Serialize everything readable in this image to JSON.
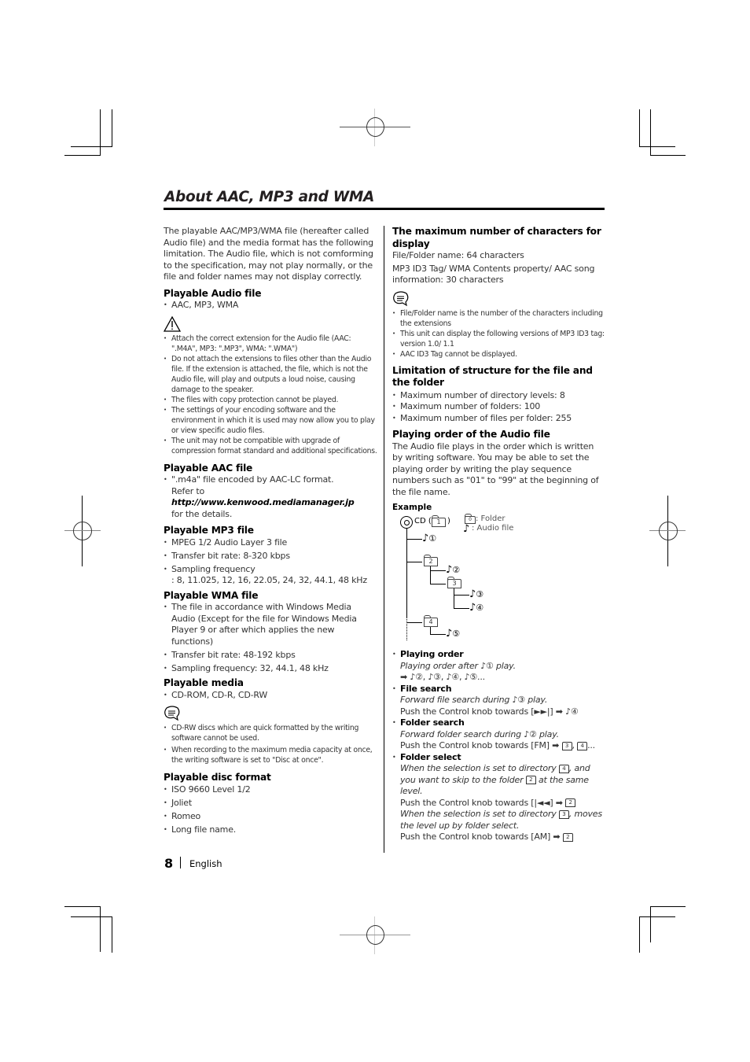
{
  "title": "About AAC, MP3 and WMA",
  "intro": "The playable AAC/MP3/WMA file (hereafter called Audio file) and the media format has the following limitation. The Audio file, which is not comforming to the specification, may not play normally, or the file and folder names may not display correctly.",
  "audio_file": {
    "heading": "Playable Audio file",
    "items": [
      "AAC, MP3, WMA"
    ],
    "caution_icon": "warning-triangle-icon",
    "cautions": [
      "Attach the correct extension for the Audio file (AAC: \".M4A\", MP3: \".MP3\", WMA: \".WMA\")",
      "Do not attach the extensions to files other than the Audio file. If the extension is attached, the file, which is not the Audio file, will play and outputs a loud noise, causing damage to the speaker.",
      "The files with copy protection cannot be played.",
      "The settings of your encoding software and the environment in which it is used may now allow you to play or view specific audio files.",
      "The unit may not be compatible with upgrade of compression format standard and additional specifications."
    ]
  },
  "aac_file": {
    "heading": "Playable AAC file",
    "line1": "\".m4a\" file encoded by AAC-LC format.",
    "refer_prefix": "Refer to ",
    "url": "http://www.kenwood.mediamanager.jp",
    "refer_suffix": "for the details."
  },
  "mp3_file": {
    "heading": "Playable MP3 file",
    "items": [
      "MPEG 1/2 Audio Layer 3 file",
      "Transfer bit rate: 8-320 kbps"
    ],
    "sampling_label": "Sampling frequency",
    "sampling_values": ": 8, 11.025, 12, 16, 22.05, 24, 32, 44.1, 48 kHz"
  },
  "wma_file": {
    "heading": "Playable WMA file",
    "items": [
      "The file in accordance with Windows Media Audio (Except for the file for Windows Media Player 9 or after which applies the new functions)",
      "Transfer bit rate: 48-192 kbps",
      "Sampling frequency: 32, 44.1, 48 kHz"
    ]
  },
  "media": {
    "heading": "Playable media",
    "items": [
      "CD-ROM, CD-R, CD-RW"
    ],
    "note_icon": "note-bubble-icon",
    "notes": [
      "CD-RW discs which are quick formatted by the writing software cannot be used.",
      "When recording to the maximum media capacity at once, the writing software is set to \"Disc at once\"."
    ]
  },
  "disc_format": {
    "heading": "Playable disc format",
    "items": [
      "ISO 9660 Level 1/2",
      "Joliet",
      "Romeo",
      "Long file name."
    ]
  },
  "max_chars": {
    "heading": "The maximum number of characters for display",
    "line1": "File/Folder name: 64 characters",
    "line2": "MP3 ID3 Tag/ WMA Contents property/ AAC song information: 30 characters",
    "notes": [
      "File/Folder name is the number of the characters including the extensions",
      "This unit can display the following versions of MP3 ID3 tag: version 1.0/ 1.1",
      "AAC ID3 Tag cannot be displayed."
    ]
  },
  "structure": {
    "heading": "Limitation of structure for the file and the folder",
    "items": [
      "Maximum number of directory levels: 8",
      "Maximum number of folders: 100",
      "Maximum number of files per folder: 255"
    ]
  },
  "playing_order": {
    "heading": "Playing order of the Audio file",
    "text": "The Audio file plays in the order which is written by writing software. You may be able to set the playing order by writing the play sequence numbers such as \"01\" to \"99\" at the beginning of the file name.",
    "example_label": "Example",
    "tree": {
      "root_label": "CD (",
      "root_close": ")",
      "folders": [
        "1",
        "2",
        "3",
        "4"
      ],
      "files": [
        "①",
        "②",
        "③",
        "④",
        "⑤"
      ],
      "legend_folder_box": "0",
      "legend_folder": ": Folder",
      "legend_file": ": Audio file"
    }
  },
  "operations": [
    {
      "label": "Playing order",
      "line1": "Playing order after ",
      "line1_ref": "①",
      "line1_end": " play.",
      "line2": "➡ ♪②, ♪③, ♪④, ♪⑤..."
    },
    {
      "label": "File search",
      "line1": "Forward file search during ",
      "line1_ref": "③",
      "line1_end": " play.",
      "line2": "Push the Control knob towards [►►|] ➡ ♪④"
    },
    {
      "label": "Folder search",
      "line1": "Forward folder search during ",
      "line1_ref": "②",
      "line1_end": " play.",
      "line2_prefix": "Push the Control knob towards [FM] ➡ ",
      "line2_folders": [
        "3",
        "4"
      ],
      "line2_suffix": "..."
    },
    {
      "label": "Folder select",
      "a_prefix": "When the selection is set to directory ",
      "a_folder": "4",
      "a_mid": ", and you want to skip to the folder ",
      "a_folder2": "2",
      "a_end": " at the same level.",
      "a_push": "Push the Control knob towards [|◄◄] ➡ ",
      "a_push_folder": "2",
      "b_prefix": "When  the selection is set to directory ",
      "b_folder": "3",
      "b_end": ", moves the level up by folder select.",
      "b_push": "Push the Control knob towards [AM] ➡ ",
      "b_push_folder": "2"
    }
  ],
  "footer": {
    "page_number": "8",
    "language": "English"
  }
}
